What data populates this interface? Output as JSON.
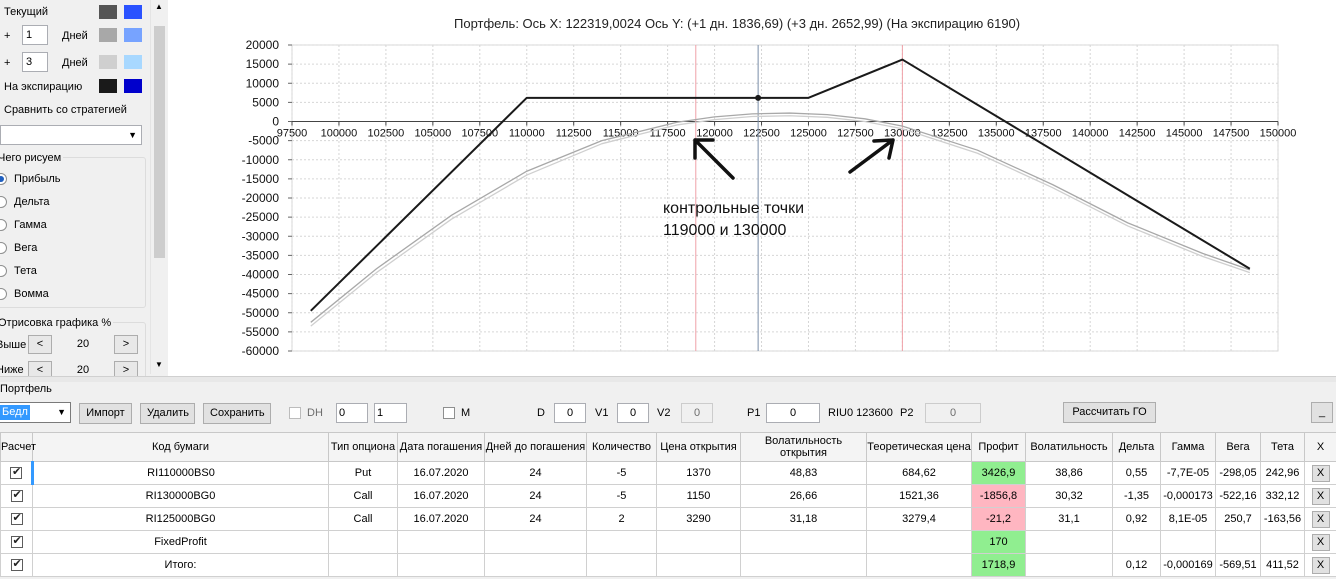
{
  "left_panel": {
    "current_label": "Текущий",
    "plus1": {
      "sign": "+",
      "value": "1",
      "unit": "Дней"
    },
    "plus3": {
      "sign": "+",
      "value": "3",
      "unit": "Дней"
    },
    "expiry_label": "На экспирацию",
    "compare_label": "Сравнить со стратегией",
    "compare_value": "",
    "draw_group_label": "Чего рисуем",
    "radios": [
      {
        "label": "Прибыль",
        "checked": true
      },
      {
        "label": "Дельта",
        "checked": false
      },
      {
        "label": "Гамма",
        "checked": false
      },
      {
        "label": "Вега",
        "checked": false
      },
      {
        "label": "Тета",
        "checked": false
      },
      {
        "label": "Вомма",
        "checked": false
      }
    ],
    "render_group_label": "Отрисовка графика %",
    "above_label": "Выше",
    "above_value": "20",
    "below_label": "Ниже",
    "below_value": "20",
    "btn_less": "<",
    "btn_more": ">",
    "swatch_colors": {
      "current": [
        "#555555",
        "#2a52ff"
      ],
      "plus1": [
        "#a8a8a8",
        "#77a3ff"
      ],
      "plus3": [
        "#cfcfcf",
        "#a8d8ff"
      ],
      "expiry": [
        "#1a1a1a",
        "#0000cc"
      ]
    }
  },
  "chart_title": "Портфель: Ось X: 122319,0024 Ось Y:  (+1 дн. 1836,69)  (+3 дн. 2652,99)  (На экспирацию 6190)",
  "annotation": {
    "line1": "контрольные точки",
    "line2": "119000 и 130000"
  },
  "chart_data": {
    "type": "line",
    "xlim": [
      97500,
      150000
    ],
    "ylim": [
      -60000,
      20000
    ],
    "x_ticks": [
      97500,
      100000,
      102500,
      105000,
      107500,
      110000,
      112500,
      115000,
      117500,
      120000,
      122500,
      125000,
      127500,
      130000,
      132500,
      135000,
      137500,
      140000,
      142500,
      145000,
      147500,
      150000
    ],
    "x_tick_labels": [
      "97500",
      "100000",
      "102500",
      "105000",
      "107500",
      "110000",
      "112500",
      "115000",
      "117500",
      "120000",
      "122500",
      "125000",
      "127500",
      "130000",
      "132500",
      "135000",
      "137500",
      "140000",
      "142500",
      "145000",
      "147500",
      "150000"
    ],
    "y_ticks": [
      20000,
      15000,
      10000,
      5000,
      0,
      -5000,
      -10000,
      -15000,
      -20000,
      -25000,
      -30000,
      -35000,
      -40000,
      -45000,
      -50000,
      -55000,
      -60000
    ],
    "y_tick_labels": [
      "20000",
      "15000",
      "10000",
      "5000",
      "0",
      "-5000",
      "-10000",
      "-15000",
      "-20000",
      "-25000",
      "-30000",
      "-35000",
      "-40000",
      "-45000",
      "-50000",
      "-55000",
      "-60000"
    ],
    "grid": true,
    "vertical_lines": [
      {
        "x": 119000,
        "color": "#f0a0a8"
      },
      {
        "x": 122319,
        "color": "#7a8ea8"
      },
      {
        "x": 130000,
        "color": "#f0a0a8"
      }
    ],
    "marker": {
      "x": 122319,
      "y": 6190
    },
    "series": [
      {
        "color": "#1a1a1a",
        "width": 2,
        "x": [
          98500,
          110000,
          125000,
          130000,
          148500
        ],
        "y": [
          -49500,
          6190,
          6190,
          16190,
          -38500
        ]
      },
      {
        "color": "#a8a8a8",
        "width": 1.3,
        "x": [
          98500,
          102000,
          106000,
          110000,
          114000,
          118000,
          120000,
          122000,
          124000,
          126000,
          128000,
          130000,
          134000,
          138000,
          142000,
          146000,
          148500
        ],
        "y": [
          -52500,
          -38500,
          -24500,
          -13000,
          -5000,
          -200,
          1200,
          2000,
          2200,
          1800,
          700,
          -1200,
          -7500,
          -16500,
          -26500,
          -34500,
          -38800
        ]
      },
      {
        "color": "#cfcfcf",
        "width": 1.3,
        "x": [
          98500,
          102000,
          106000,
          110000,
          114000,
          118000,
          120000,
          122000,
          124000,
          126000,
          128000,
          130000,
          134000,
          138000,
          142000,
          146000,
          148500
        ],
        "y": [
          -53500,
          -39500,
          -25500,
          -14000,
          -5800,
          -900,
          500,
          1300,
          1500,
          1100,
          0,
          -1900,
          -8300,
          -17300,
          -27300,
          -35300,
          -39500
        ]
      }
    ]
  },
  "portfolio": {
    "label": "Портфель",
    "selector_value": "Бедл",
    "btn_import": "Импорт",
    "btn_delete": "Удалить",
    "btn_save": "Сохранить",
    "dh_label": "DH",
    "spin1": "0",
    "spin2": "1",
    "m_label": "M",
    "d_label": "D",
    "d_value": "0",
    "v1_label": "V1",
    "v1_value": "0",
    "v2_label": "V2",
    "v2_value": "0",
    "p1_label": "P1",
    "p1_value": "0",
    "riu_label": "RIU0 123600",
    "p2_label": "P2",
    "p2_value": "0",
    "btn_calc": "Рассчитать ГО",
    "btn_min": "_"
  },
  "table": {
    "headers": [
      "Расчет",
      "Код бумаги",
      "Тип опциона",
      "Дата погашения",
      "Дней до погашения",
      "Количество",
      "Цена открытия",
      "Волатильность открытия",
      "Теоретическая цена",
      "Профит",
      "Волатильность",
      "Дельта",
      "Гамма",
      "Вега",
      "Тета",
      "X"
    ],
    "rows": [
      [
        "",
        "RI110000BS0",
        "Put",
        "16.07.2020",
        "24",
        "-5",
        "1370",
        "48,83",
        "684,62",
        "3426,9",
        "38,86",
        "0,55",
        "-7,7E-05",
        "-298,05",
        "242,96",
        "X"
      ],
      [
        "",
        "RI130000BG0",
        "Call",
        "16.07.2020",
        "24",
        "-5",
        "1150",
        "26,66",
        "1521,36",
        "-1856,8",
        "30,32",
        "-1,35",
        "-0,000173",
        "-522,16",
        "332,12",
        "X"
      ],
      [
        "",
        "RI125000BG0",
        "Call",
        "16.07.2020",
        "24",
        "2",
        "3290",
        "31,18",
        "3279,4",
        "-21,2",
        "31,1",
        "0,92",
        "8,1E-05",
        "250,7",
        "-163,56",
        "X"
      ],
      [
        "",
        "FixedProfit",
        "",
        "",
        "",
        "",
        "",
        "",
        "",
        "170",
        "",
        "",
        "",
        "",
        "",
        "X"
      ],
      [
        "",
        "Итого:",
        "",
        "",
        "",
        "",
        "",
        "",
        "",
        "1718,9",
        "",
        "0,12",
        "-0,000169",
        "-569,51",
        "411,52",
        "X"
      ]
    ],
    "profit_states": [
      "pos",
      "neg",
      "neg",
      "pos",
      "pos"
    ]
  }
}
